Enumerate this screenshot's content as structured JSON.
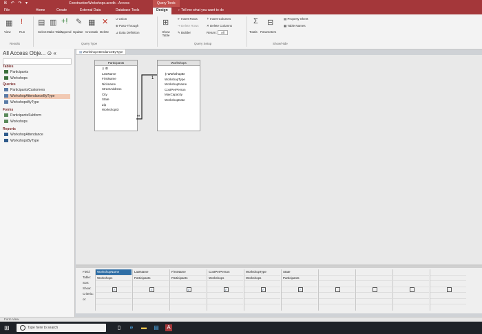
{
  "window": {
    "title": "ConstructionWorkshops.accdb - Access",
    "qat_icons": "B ↶ ↷ ▾"
  },
  "context_tab": "Query Tools",
  "tabs": [
    "File",
    "Home",
    "Create",
    "External Data",
    "Database Tools",
    "Design"
  ],
  "tell_me": "Tell me what you want to do",
  "ribbon": {
    "results": {
      "view": "View",
      "run": "Run",
      "label": "Results"
    },
    "query_type": {
      "select": "Select",
      "make_table": "Make Table",
      "append": "Append",
      "update": "Update",
      "crosstab": "Crosstab",
      "delete": "Delete",
      "union": "Union",
      "pass_through": "Pass-Through",
      "data_definition": "Data Definition",
      "label": "Query Type"
    },
    "setup": {
      "show_table": "Show Table",
      "insert_rows": "Insert Rows",
      "delete_rows": "Delete Rows",
      "builder": "Builder",
      "insert_columns": "Insert Columns",
      "delete_columns": "Delete Columns",
      "return": "Return:",
      "return_value": "All",
      "label": "Query Setup"
    },
    "showhide": {
      "totals": "Totals",
      "parameters": "Parameters",
      "property_sheet": "Property Sheet",
      "table_names": "Table Names",
      "label": "Show/Hide"
    }
  },
  "nav": {
    "title": "All Access Obje...",
    "groups": {
      "tables": "Tables",
      "queries": "Queries",
      "forms": "Forms",
      "reports": "Reports"
    },
    "tables": [
      "Participants",
      "Workshops"
    ],
    "queries": [
      "ParticipantsCustomers",
      "WorkshopAttendanceByType",
      "WorkshopsByType"
    ],
    "forms": [
      "ParticipantsSubform",
      "Workshops"
    ],
    "reports": [
      "WorkshopAttendance",
      "WorkshopsByType"
    ]
  },
  "document_tab": "WorkshopAttendanceByType",
  "tables": {
    "participants": {
      "title": "Participants",
      "fields": [
        "ID",
        "LastName",
        "FirstName",
        "Nickname",
        "StreetAddress",
        "City",
        "State",
        "Zip",
        "WorkshopID"
      ]
    },
    "workshops": {
      "title": "Workshops",
      "fields": [
        "WorkshopID",
        "WorkshopType",
        "WorkshopName",
        "CostPerPerson",
        "MaxCapacity",
        "WorkshopDate"
      ]
    }
  },
  "join": {
    "one": "1",
    "many": "∞"
  },
  "grid": {
    "row_labels": [
      "Field:",
      "Table:",
      "Sort:",
      "Show:",
      "Criteria:",
      "or:"
    ],
    "columns": [
      {
        "field": "WorkshopName",
        "table": "Workshops",
        "show": true,
        "highlight": true
      },
      {
        "field": "LastName",
        "table": "Participants",
        "show": true
      },
      {
        "field": "FirstName",
        "table": "Participants",
        "show": true
      },
      {
        "field": "CostPerPerson",
        "table": "Workshops",
        "show": true
      },
      {
        "field": "WorkshopType",
        "table": "Workshops",
        "show": true
      },
      {
        "field": "State",
        "table": "Participants",
        "show": true
      },
      {
        "field": "",
        "table": "",
        "show": false
      },
      {
        "field": "",
        "table": "",
        "show": false
      },
      {
        "field": "",
        "table": "",
        "show": false
      },
      {
        "field": "",
        "table": "",
        "show": false
      }
    ]
  },
  "status": "Form View",
  "taskbar": {
    "search_placeholder": "Type here to search"
  }
}
